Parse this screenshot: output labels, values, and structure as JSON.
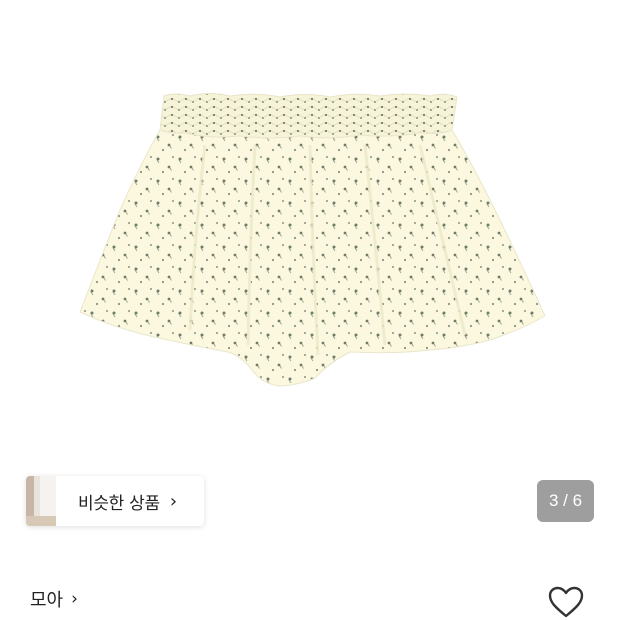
{
  "product_image": {
    "description_icon": "floral-shorts-image",
    "fabric_color": "#fbf8df",
    "print_color": "#6f7c6a"
  },
  "similar": {
    "label": "비슷한 상품",
    "chevron": "›"
  },
  "gallery": {
    "counter": "3 / 6"
  },
  "store": {
    "name": "모아",
    "chevron": "›"
  },
  "wishlist": {
    "icon": "heart-outline-icon"
  }
}
